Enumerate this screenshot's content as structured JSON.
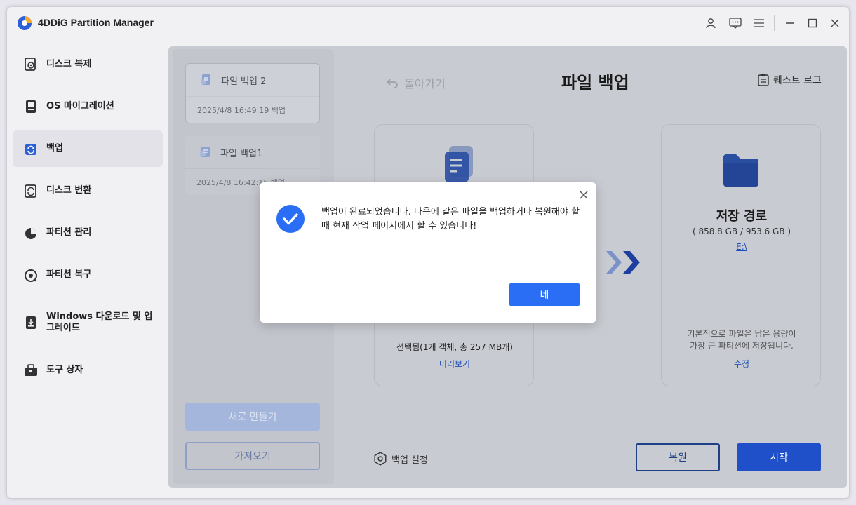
{
  "app": {
    "title": "4DDiG Partition Manager"
  },
  "titlebar": {
    "icons": [
      "user-icon",
      "feedback-icon",
      "menu-icon",
      "minimize-icon",
      "maximize-icon",
      "close-icon"
    ]
  },
  "sidebar": {
    "items": [
      {
        "label": "디스크 복제",
        "icon": "disk-clone-icon",
        "active": false
      },
      {
        "label": "OS 마이그레이션",
        "icon": "os-migration-icon",
        "active": false
      },
      {
        "label": "백업",
        "icon": "backup-icon",
        "active": true
      },
      {
        "label": "디스크 변환",
        "icon": "disk-convert-icon",
        "active": false
      },
      {
        "label": "파티션 관리",
        "icon": "partition-manage-icon",
        "active": false
      },
      {
        "label": "파티션 복구",
        "icon": "partition-recovery-icon",
        "active": false
      },
      {
        "label": "Windows 다운로드 및 업그레이드",
        "icon": "windows-download-icon",
        "active": false
      },
      {
        "label": "도구 상자",
        "icon": "toolbox-icon",
        "active": false
      }
    ]
  },
  "backups": [
    {
      "name": "파일 백업 2",
      "time": "2025/4/8 16:49:19 백업"
    },
    {
      "name": "파일 백업1",
      "time": "2025/4/8 16:42:16 백업"
    }
  ],
  "left_panel": {
    "new_label": "새로 만들기",
    "import_label": "가져오기"
  },
  "main": {
    "back_label": "돌아가기",
    "title": "파일 백업",
    "quest_log": "퀘스트 로그",
    "source": {
      "selected": "선택됨(1개 객체, 총 257 MB개)",
      "preview": "미리보기"
    },
    "destination": {
      "title": "저장 경로",
      "size": "( 858.8 GB / 953.6 GB )",
      "drive": "E:\\",
      "note_line1": "기본적으로 파일은 남은 용량이",
      "note_line2": "가장 큰 파티션에 저장됩니다.",
      "edit": "수정"
    },
    "backup_settings": "백업 설정",
    "restore_label": "복원",
    "start_label": "시작"
  },
  "dialog": {
    "message": "백업이 완료되었습니다. 다음에 같은 파일을 백업하거나 복원해야 할 때 현재 작업 페이지에서 할 수 있습니다!",
    "ok_label": "네"
  },
  "colors": {
    "accent": "#2a6ef6",
    "primary": "#1f4fc9",
    "dim_overlay": "#c9cbd2"
  }
}
